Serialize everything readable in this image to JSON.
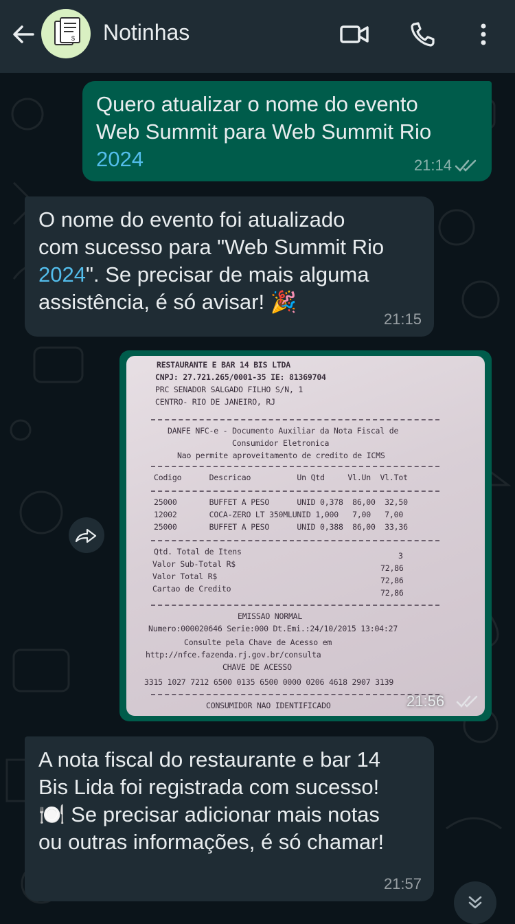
{
  "header": {
    "contact_name": "Notinhas",
    "back_icon": "arrow-left-icon",
    "video_icon": "video-call-icon",
    "phone_icon": "phone-call-icon",
    "menu_icon": "more-vertical-icon"
  },
  "messages": [
    {
      "direction": "outgoing",
      "text_part1": "Quero atualizar o nome do evento\nWeb Summit para Web Summit Rio\n",
      "link": "2024",
      "time": "21:14",
      "status": "read"
    },
    {
      "direction": "incoming",
      "text_part1": "O nome do evento foi atualizado\ncom sucesso para \"Web Summit Rio\n",
      "link": "2024",
      "text_part2": "\". Se precisar de mais alguma\nassistência, é só avisar! 🎉",
      "time": "21:15"
    },
    {
      "direction": "outgoing",
      "type": "image",
      "time": "21:56",
      "status": "read",
      "receipt": {
        "header": [
          "RESTAURANTE E BAR 14 BIS LTDA",
          "CNPJ: 27.721.265/0001-35 IE: 81369704",
          "PRC SENADOR SALGADO FILHO S/N, 1",
          "CENTRO- RIO DE JANEIRO, RJ"
        ],
        "danfe": [
          "DANFE NFC-e - Documento Auxiliar da Nota Fiscal de",
          "Consumidor Eletronica",
          "Nao permite aproveitamento de credito de ICMS"
        ],
        "columns": "Codigo      Descricao          Un Qtd     Vl.Un  Vl.Tot",
        "items": [
          "25000       BUFFET A PESO      UNID 0,378  86,00  32,50",
          "12002       COCA-ZERO LT 350MLUNID 1,000   7,00   7,00",
          "25000       BUFFET A PESO      UNID 0,388  86,00  33,36"
        ],
        "totals": [
          {
            "label": "Qtd. Total de Itens",
            "value": "3"
          },
          {
            "label": "Valor Sub-Total R$",
            "value": "72,86"
          },
          {
            "label": "Valor Total R$",
            "value": "72,86"
          },
          {
            "label": "Cartao de Credito",
            "value": "72,86"
          }
        ],
        "footer": [
          "EMISSAO NORMAL",
          "Numero:000020646 Serie:000 Dt.Emi.:24/10/2015 13:04:27",
          "Consulte pela Chave de Acesso em",
          "http://nfce.fazenda.rj.gov.br/consulta",
          "CHAVE DE ACESSO",
          "3315 1027 7212 6500 0135 6500 0000 0206 4618 2907 3139",
          "CONSUMIDOR NAO IDENTIFICADO"
        ]
      }
    },
    {
      "direction": "incoming",
      "text_part1": "A nota fiscal do restaurante e bar 14\nBis Lida foi registrada com sucesso!\n🍽️ Se precisar adicionar mais notas\nou outras informações, é só chamar!",
      "time": "21:57"
    }
  ],
  "colors": {
    "background": "#0b141a",
    "header": "#1f2c34",
    "outgoing_bubble": "#005c4b",
    "incoming_bubble": "#1f2c34",
    "link": "#53bdeb"
  }
}
